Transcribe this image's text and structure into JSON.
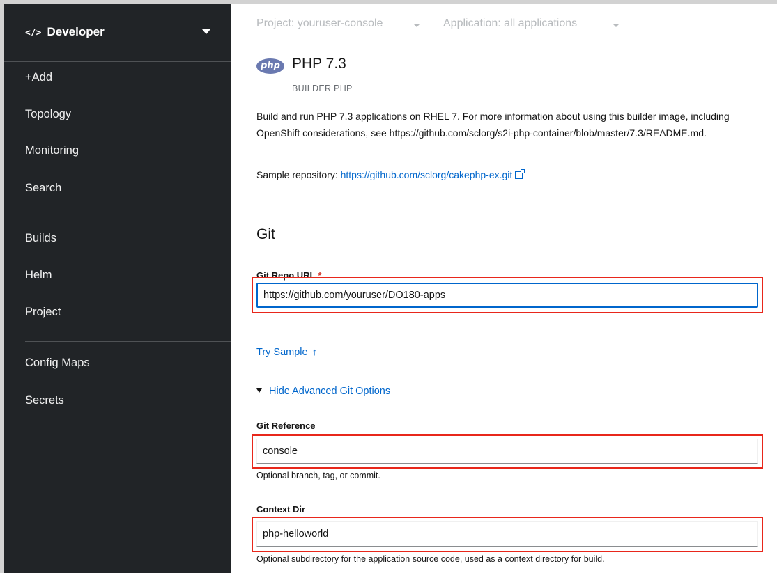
{
  "sidebar": {
    "perspective": {
      "icon": "code-icon",
      "label": "Developer"
    },
    "items": [
      {
        "label": "+Add"
      },
      {
        "label": "Topology"
      },
      {
        "label": "Monitoring"
      },
      {
        "label": "Search"
      },
      {
        "label": "Builds"
      },
      {
        "label": "Helm"
      },
      {
        "label": "Project"
      },
      {
        "label": "Config Maps"
      },
      {
        "label": "Secrets"
      }
    ]
  },
  "topbar": {
    "project": "Project: youruser-console",
    "application": "Application: all applications"
  },
  "builder": {
    "logo_text": "php",
    "title": "PHP 7.3",
    "subtitle": "BUILDER PHP",
    "description": "Build and run PHP 7.3 applications on RHEL 7. For more information about using this builder image, including OpenShift considerations, see https://github.com/sclorg/s2i-php-container/blob/master/7.3/README.md.",
    "sample_label": "Sample repository:",
    "sample_url": "https://github.com/sclorg/cakephp-ex.git"
  },
  "git": {
    "heading": "Git",
    "repo_label": "Git Repo URL",
    "required_mark": "*",
    "repo_value": "https://github.com/youruser/DO180-apps",
    "try_sample": "Try Sample",
    "advanced_toggle": "Hide Advanced Git Options",
    "reference_label": "Git Reference",
    "reference_value": "console",
    "reference_help": "Optional branch, tag, or commit.",
    "context_label": "Context Dir",
    "context_value": "php-helloworld",
    "context_help": "Optional subdirectory for the application source code, used as a context directory for build."
  },
  "colors": {
    "sidebar_bg": "#212427",
    "link": "#0066cc",
    "highlight": "#e8271b"
  }
}
